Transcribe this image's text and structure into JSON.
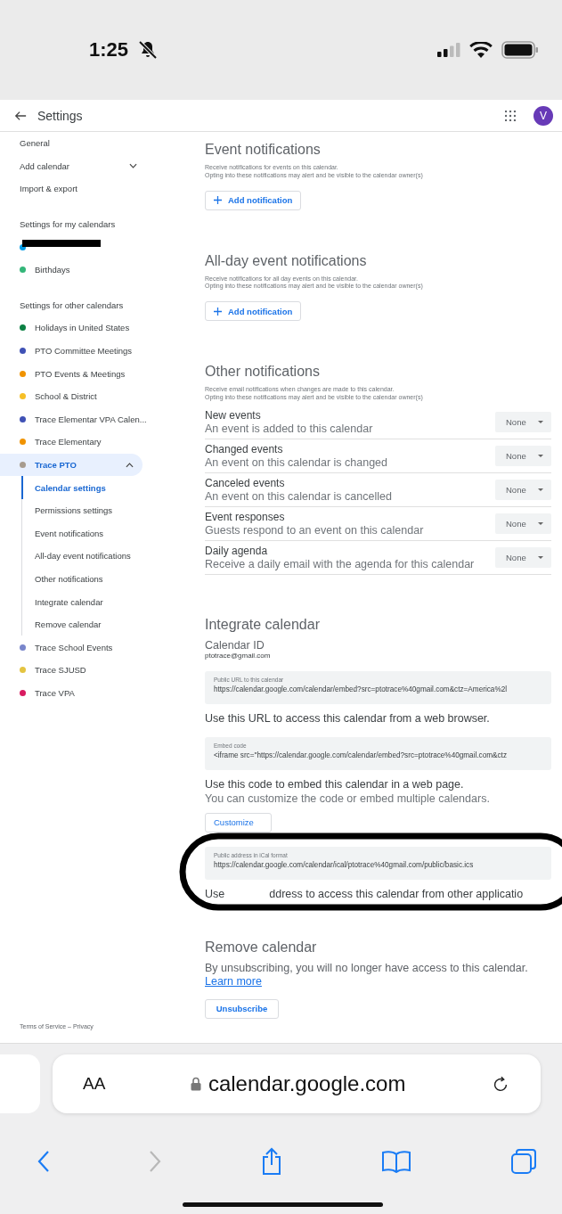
{
  "status_bar": {
    "time": "1:25",
    "silent": true
  },
  "header": {
    "title": "Settings",
    "avatar": "V"
  },
  "sidebar": {
    "top_items": [
      {
        "label": "General"
      },
      {
        "label": "Add calendar",
        "expanded": false
      },
      {
        "label": "Import & export"
      }
    ],
    "sections": [
      {
        "heading": "Settings for my calendars",
        "calendars": [
          {
            "kind": "redacted",
            "color": "#039be5"
          },
          {
            "kind": "calendar",
            "label": "Birthdays",
            "color": "#33b679",
            "selected": false
          }
        ]
      },
      {
        "heading": "Settings for other calendars",
        "calendars": [
          {
            "kind": "calendar",
            "label": "Holidays in United States",
            "color": "#0b8043",
            "selected": false
          },
          {
            "kind": "calendar",
            "label": "PTO Committee Meetings",
            "color": "#3f51b5",
            "selected": false
          },
          {
            "kind": "calendar",
            "label": "PTO Events & Meetings",
            "color": "#f09300",
            "selected": false
          },
          {
            "kind": "calendar",
            "label": "School & District",
            "color": "#f6bf26",
            "selected": false
          },
          {
            "kind": "calendar",
            "label": "Trace Elementar VPA Calen...",
            "color": "#3f51b5",
            "selected": false
          },
          {
            "kind": "calendar",
            "label": "Trace Elementary",
            "color": "#f09300",
            "selected": false
          },
          {
            "kind": "calendar",
            "label": "Trace PTO",
            "color": "#a79b8e",
            "selected": true,
            "expanded": true,
            "children": [
              {
                "label": "Calendar settings",
                "selected": true
              },
              {
                "label": "Permissions settings",
                "selected": false
              },
              {
                "label": "Event notifications",
                "selected": false
              },
              {
                "label": "All-day event notifications",
                "selected": false
              },
              {
                "label": "Other notifications",
                "selected": false
              },
              {
                "label": "Integrate calendar",
                "selected": false
              },
              {
                "label": "Remove calendar",
                "selected": false
              }
            ]
          },
          {
            "kind": "calendar",
            "label": "Trace School Events",
            "color": "#7986cb",
            "selected": false
          },
          {
            "kind": "calendar",
            "label": "Trace SJUSD",
            "color": "#e4c441",
            "selected": false
          },
          {
            "kind": "calendar",
            "label": "Trace VPA",
            "color": "#d81b60",
            "selected": false
          }
        ]
      }
    ]
  },
  "event_notifications": {
    "heading": "Event notifications",
    "description": [
      "Receive notifications for events on this calendar.",
      "Opting into these notifications may alert and be visible to the calendar owner(s)"
    ],
    "button": "Add notification"
  },
  "all_day_notifications": {
    "heading": "All-day event notifications",
    "description": [
      "Receive notifications for all day events on this calendar.",
      "Opting into these notifications may alert and be visible to the calendar owner(s)"
    ],
    "button": "Add notification"
  },
  "other_notifications": {
    "heading": "Other notifications",
    "description": [
      "Receive email notifications when changes are made to this calendar.",
      "Opting into these notifications may alert and be visible to the calendar owner(s)"
    ],
    "rows": [
      {
        "title": "New events",
        "subtitle": "An event is added to this calendar",
        "value": "None"
      },
      {
        "title": "Changed events",
        "subtitle": "An event on this calendar is changed",
        "value": "None"
      },
      {
        "title": "Canceled events",
        "subtitle": "An event on this calendar is cancelled",
        "value": "None"
      },
      {
        "title": "Event responses",
        "subtitle": "Guests respond to an event on this calendar",
        "value": "None"
      },
      {
        "title": "Daily agenda",
        "subtitle": "Receive a daily email with the agenda for this calendar",
        "value": "None"
      }
    ]
  },
  "integrate_calendar": {
    "heading": "Integrate calendar",
    "calendar_id_label": "Calendar ID",
    "calendar_id": "ptotrace@gmail.com",
    "public_url": {
      "label": "Public URL to this calendar",
      "value": "https://calendar.google.com/calendar/embed?src=ptotrace%40gmail.com&ctz=America%2l"
    },
    "public_url_note": "Use this URL to access this calendar from a web browser.",
    "embed_code": {
      "label": "Embed code",
      "value": "<iframe src=\"https://calendar.google.com/calendar/embed?src=ptotrace%40gmail.com&ctz"
    },
    "embed_note": "Use this code to embed this calendar in a web page.",
    "embed_hint": "You can customize the code or embed multiple calendars.",
    "customize_button": "Customize",
    "ical": {
      "label": "Public address in iCal format",
      "value": "https://calendar.google.com/calendar/ical/ptotrace%40gmail.com/public/basic.ics"
    },
    "ical_note": [
      "Use",
      "ddress to access this calendar from other applicatio"
    ]
  },
  "annotation": {
    "kind": "ellipse"
  },
  "remove_calendar": {
    "heading": "Remove calendar",
    "text": "By unsubscribing, you will no longer have access to this calendar.",
    "link": "Learn more",
    "button": "Unsubscribe"
  },
  "footer": "Terms of Service – Privacy",
  "browser": {
    "text_size": "AA",
    "url": "calendar.google.com"
  }
}
